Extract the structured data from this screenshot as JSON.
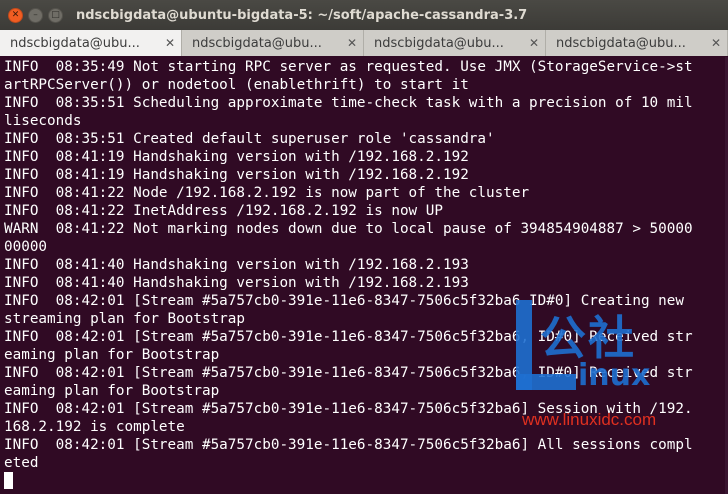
{
  "window": {
    "title": "ndscbigdata@ubuntu-bigdata-5: ~/soft/apache-cassandra-3.7"
  },
  "tabs": [
    {
      "label": "ndscbigdata@ubu...",
      "active": true
    },
    {
      "label": "ndscbigdata@ubu...",
      "active": false
    },
    {
      "label": "ndscbigdata@ubu...",
      "active": false
    },
    {
      "label": "ndscbigdata@ubu...",
      "active": false
    }
  ],
  "terminal": {
    "lines": [
      "INFO  08:35:49 Not starting RPC server as requested. Use JMX (StorageService->st",
      "artRPCServer()) or nodetool (enablethrift) to start it",
      "INFO  08:35:51 Scheduling approximate time-check task with a precision of 10 mil",
      "liseconds",
      "INFO  08:35:51 Created default superuser role 'cassandra'",
      "INFO  08:41:19 Handshaking version with /192.168.2.192",
      "INFO  08:41:19 Handshaking version with /192.168.2.192",
      "INFO  08:41:22 Node /192.168.2.192 is now part of the cluster",
      "INFO  08:41:22 InetAddress /192.168.2.192 is now UP",
      "WARN  08:41:22 Not marking nodes down due to local pause of 394854904887 > 50000",
      "00000",
      "INFO  08:41:40 Handshaking version with /192.168.2.193",
      "INFO  08:41:40 Handshaking version with /192.168.2.193",
      "INFO  08:42:01 [Stream #5a757cb0-391e-11e6-8347-7506c5f32ba6 ID#0] Creating new",
      "streaming plan for Bootstrap",
      "INFO  08:42:01 [Stream #5a757cb0-391e-11e6-8347-7506c5f32ba6, ID#0] Received str",
      "eaming plan for Bootstrap",
      "INFO  08:42:01 [Stream #5a757cb0-391e-11e6-8347-7506c5f32ba6, ID#0] Received str",
      "eaming plan for Bootstrap",
      "INFO  08:42:01 [Stream #5a757cb0-391e-11e6-8347-7506c5f32ba6] Session with /192.",
      "168.2.192 is complete",
      "INFO  08:42:01 [Stream #5a757cb0-391e-11e6-8347-7506c5f32ba6] All sessions compl",
      "eted"
    ]
  },
  "watermark": {
    "cn_text": "公社",
    "brand": "inux",
    "url": "www.linuxidc.com"
  },
  "colors": {
    "terminal_bg": "#300a24",
    "terminal_fg": "#ffffff",
    "watermark_blue": "#1e6fd0",
    "watermark_red": "#e03020"
  }
}
